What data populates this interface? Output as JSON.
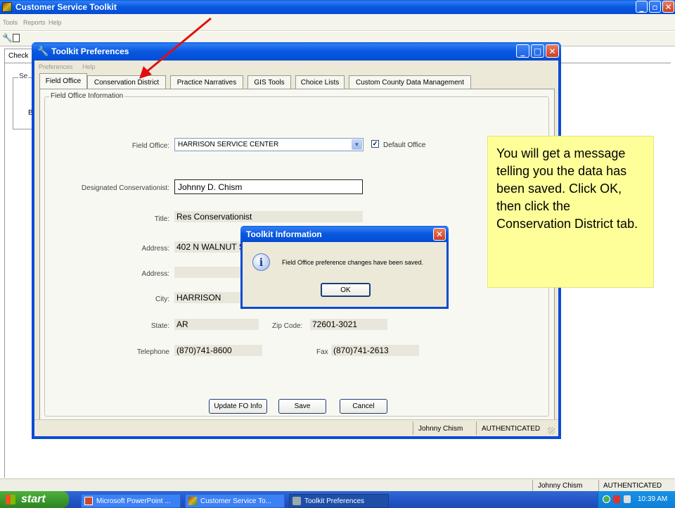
{
  "main_window": {
    "title": "Customer Service Toolkit",
    "menu": [
      "Tools",
      "Reports",
      "Help"
    ],
    "partial_tab": "Check",
    "partial_group": "Se",
    "partial_text": "Bu",
    "status_user": "Johnny Chism",
    "status_auth": "AUTHENTICATED"
  },
  "prefs_window": {
    "title": "Toolkit Preferences",
    "menu": [
      "Preferences",
      "Help"
    ],
    "tabs": [
      "Field Office",
      "Conservation District",
      "Practice Narratives",
      "GIS Tools",
      "Choice Lists",
      "Custom County Data Management"
    ],
    "group_title": "Field Office Information",
    "fields": {
      "field_office_label": "Field Office:",
      "field_office_value": "HARRISON SERVICE CENTER",
      "default_office_label": "Default Office",
      "default_office_checked": true,
      "designated_label": "Designated Conservationist:",
      "designated_value": "Johnny D. Chism",
      "title_label": "Title:",
      "title_value": "Res Conservationist",
      "address_label": "Address:",
      "address_value": "402 N WALNUT ST STE 107",
      "address2_label": "Address:",
      "address2_value": "",
      "city_label": "City:",
      "city_value": "HARRISON",
      "state_label": "State:",
      "state_value": "AR",
      "zip_label": "Zip Code:",
      "zip_value": "72601-3021",
      "telephone_label": "Telephone",
      "telephone_value": "(870)741-8600",
      "fax_label": "Fax",
      "fax_value": "(870)741-2613"
    },
    "buttons": {
      "update": "Update FO Info",
      "save": "Save",
      "cancel": "Cancel"
    },
    "status_user": "Johnny Chism",
    "status_auth": "AUTHENTICATED"
  },
  "dialog": {
    "title": "Toolkit Information",
    "message": "Field Office preference changes have been saved.",
    "ok": "OK"
  },
  "callout": {
    "text": "You will get a message telling you the data has been saved. Click OK, then click the Conservation District tab."
  },
  "taskbar": {
    "start": "start",
    "items": [
      "Microsoft PowerPoint ...",
      "Customer Service To...",
      "Toolkit Preferences"
    ],
    "clock": "10:39 AM"
  },
  "colors": {
    "xp_blue": "#0a5fe8",
    "callout_bg": "#ffff99",
    "arrow": "#e01010",
    "start_green": "#3c9a2e"
  }
}
